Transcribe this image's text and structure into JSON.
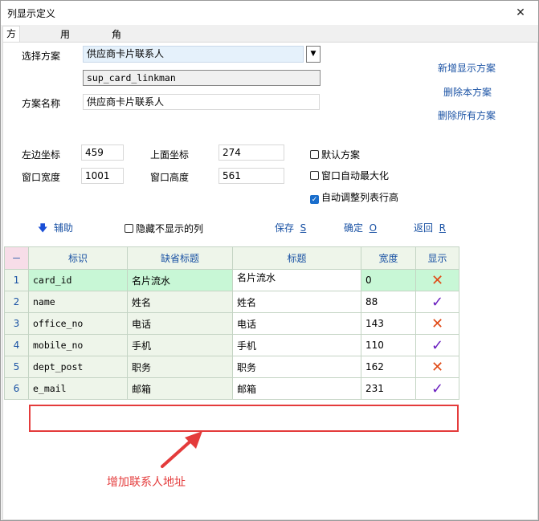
{
  "window": {
    "title": "列显示定义",
    "close_glyph": "✕"
  },
  "tabs": [
    {
      "label": "方案设置",
      "active": true
    },
    {
      "label": "用户绑定",
      "active": false
    },
    {
      "label": "角色绑定",
      "active": false
    }
  ],
  "scheme": {
    "select_label": "选择方案",
    "select_value": "供应商卡片联系人",
    "code_value": "sup_card_linkman",
    "name_label": "方案名称",
    "name_value": "供应商卡片联系人"
  },
  "scheme_actions": {
    "add": "新增显示方案",
    "delete": "删除本方案",
    "delete_all": "删除所有方案"
  },
  "position": {
    "left_label": "左边坐标",
    "left_value": "459",
    "top_label": "上面坐标",
    "top_value": "274",
    "width_label": "窗口宽度",
    "width_value": "1001",
    "height_label": "窗口高度",
    "height_value": "561"
  },
  "options": {
    "default_scheme": {
      "label": "默认方案",
      "checked": false
    },
    "auto_maximize": {
      "label": "窗口自动最大化",
      "checked": false
    },
    "auto_row_height": {
      "label": "自动调整列表行高",
      "checked": true
    },
    "hide_invisible": {
      "label": "隐藏不显示的列",
      "checked": false
    }
  },
  "toolbar": {
    "assist": "辅助",
    "save": "保存",
    "save_key": "S",
    "ok": "确定",
    "ok_key": "O",
    "back": "返回",
    "back_key": "R"
  },
  "grid": {
    "corner": "－",
    "headers": {
      "id": "标识",
      "default_title": "缺省标题",
      "title": "标题",
      "width": "宽度",
      "show": "显示"
    },
    "rows": [
      {
        "n": "1",
        "id": "card_id",
        "default_title": "名片流水",
        "title": "名片流水",
        "width": "0",
        "show": false
      },
      {
        "n": "2",
        "id": "name",
        "default_title": "姓名",
        "title": "姓名",
        "width": "88",
        "show": true
      },
      {
        "n": "3",
        "id": "office_no",
        "default_title": "电话",
        "title": "电话",
        "width": "143",
        "show": false
      },
      {
        "n": "4",
        "id": "mobile_no",
        "default_title": "手机",
        "title": "手机",
        "width": "110",
        "show": true
      },
      {
        "n": "5",
        "id": "dept_post",
        "default_title": "职务",
        "title": "职务",
        "width": "162",
        "show": false
      },
      {
        "n": "6",
        "id": "e_mail",
        "default_title": "邮箱",
        "title": "邮箱",
        "width": "231",
        "show": true
      }
    ]
  },
  "annotation": {
    "text": "增加联系人地址",
    "color": "#e43b3b"
  },
  "colors": {
    "link": "#1a52a4",
    "selected_row": "#c8f7d6",
    "cross": "#e04a16",
    "check": "#6a1fbf"
  }
}
